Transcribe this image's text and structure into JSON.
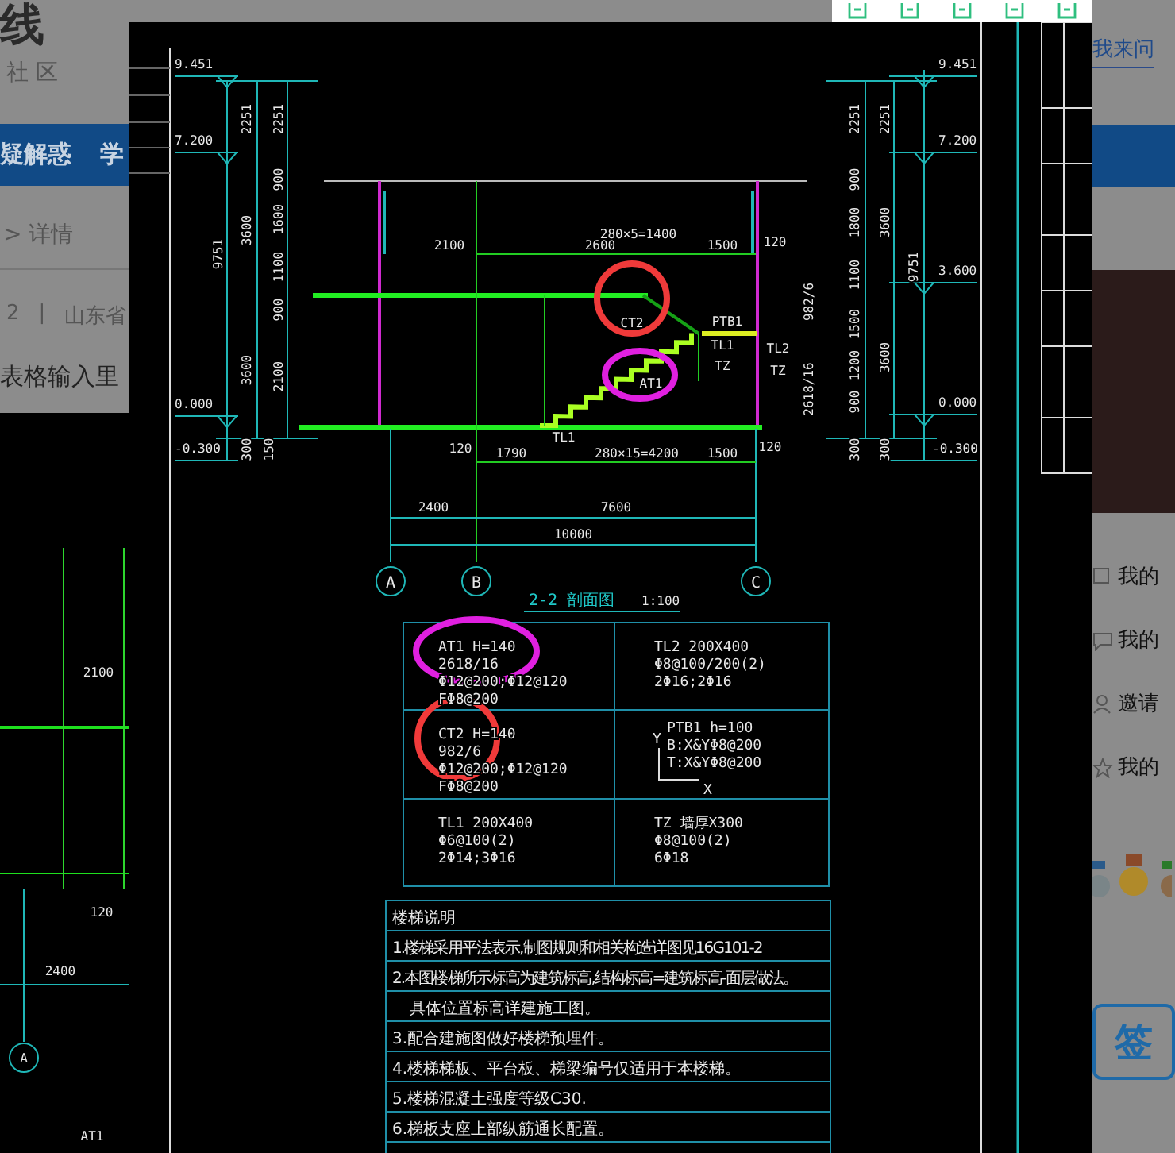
{
  "page": {
    "logo": "线",
    "subtitle": "社 区",
    "nav": [
      "疑解惑",
      "学"
    ],
    "breadcrumb": "> 详情",
    "meta": [
      "2",
      "|",
      "山东省"
    ],
    "question_title": "表格输入里"
  },
  "background_drawing": {
    "texts": [
      "2100",
      "120",
      "2400",
      "A",
      "AT1"
    ]
  },
  "drawing": {
    "elevations": [
      "9.451",
      "7.200",
      "0.000",
      "-0.300",
      "9.451",
      "7.200",
      "3.600",
      "0.000",
      "-0.300"
    ],
    "vertical_dimensions": [
      "2251",
      "2251",
      "900",
      "3600",
      "1600",
      "1100",
      "9751",
      "900",
      "3600",
      "2100",
      "300",
      "150",
      "2251",
      "2251",
      "900",
      "1800",
      "3600",
      "1100",
      "9751",
      "1500",
      "1200",
      "900",
      "3600",
      "300",
      "300",
      "982/6",
      "2618/16"
    ],
    "horizontal_dimensions": [
      "2100",
      "2600",
      "280×5=1400",
      "1500",
      "120",
      "120",
      "1790",
      "280×15=4200",
      "1500",
      "120",
      "2400",
      "7600",
      "10000"
    ],
    "member_tags": [
      "CT2",
      "PTB1",
      "TL1",
      "TZ",
      "TL2",
      "TZ",
      "AT1",
      "TL1"
    ],
    "grid_labels": [
      "A",
      "B",
      "C"
    ],
    "section_title": "2-2 剖面图",
    "scale": "1:100",
    "schedule": [
      {
        "lines": [
          "AT1   H=140",
          "2618/16",
          "Φ12@200;Φ12@120",
          "FΦ8@200"
        ]
      },
      {
        "lines": [
          "TL2   200X400",
          "Φ8@100/200(2)",
          "2Φ16;2Φ16"
        ]
      },
      {
        "lines": [
          "CT2   H=140",
          "982/6",
          "Φ12@200;Φ12@120",
          "FΦ8@200"
        ]
      },
      {
        "lines": [
          "PTB1   h=100",
          "B:X&YΦ8@200",
          "T:X&YΦ8@200"
        ]
      },
      {
        "lines": [
          "TL1   200X400",
          "Φ6@100(2)",
          "2Φ14;3Φ16"
        ]
      },
      {
        "lines": [
          "TZ   墙厚X300",
          "Φ8@100(2)",
          "6Φ18"
        ]
      }
    ],
    "axis_labels": [
      "Y",
      "X"
    ],
    "notes": [
      "楼梯说明",
      "1.楼梯采用平法表示,制图规则和相关构造详图见16G101-2",
      "2.本图楼梯所示标高为建筑标高,结构标高=建筑标高-面层做法。",
      "具体位置标高详建施工图。",
      "3.配合建施图做好楼梯预埋件。",
      "4.楼梯梯板、平台板、梯梁编号仅适用于本楼梯。",
      "5.楼梯混凝土强度等级C30.",
      "6.梯板支座上部纵筋通长配置。"
    ]
  },
  "sidebar": {
    "ask_button": "我来问",
    "menu": [
      {
        "label": "我的"
      },
      {
        "label": "我的"
      },
      {
        "label": "邀请"
      },
      {
        "label": "我的"
      }
    ],
    "sign_label": "签"
  }
}
